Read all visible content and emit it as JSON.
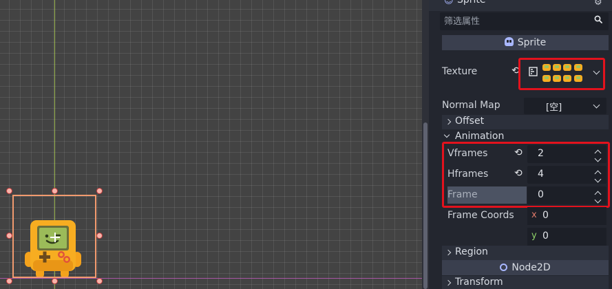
{
  "inspector": {
    "node_title": "Sprite",
    "filter_placeholder": "筛选属性",
    "class_name": "Sprite",
    "texture_label": "Texture",
    "normal_map_label": "Normal Map",
    "normal_map_value": "[空]",
    "offset_label": "Offset",
    "animation_label": "Animation",
    "vframes_label": "Vframes",
    "vframes_value": "2",
    "hframes_label": "Hframes",
    "hframes_value": "4",
    "frame_label": "Frame",
    "frame_value": "0",
    "frame_coords_label": "Frame Coords",
    "frame_coords_x_axis": "x",
    "frame_coords_x": "0",
    "frame_coords_y_axis": "y",
    "frame_coords_y": "0",
    "region_label": "Region",
    "node2d_label": "Node2D",
    "transform_label": "Transform"
  },
  "colors": {
    "highlight": "#e3121d",
    "selection": "#f29a6e",
    "accent_node": "#a9b7ff",
    "axis_x_color": "#c45abe",
    "axis_y_color": "#b9dc55"
  },
  "icons": {
    "revert": "revert-icon",
    "search": "search-icon",
    "tool": "wrench-icon"
  }
}
